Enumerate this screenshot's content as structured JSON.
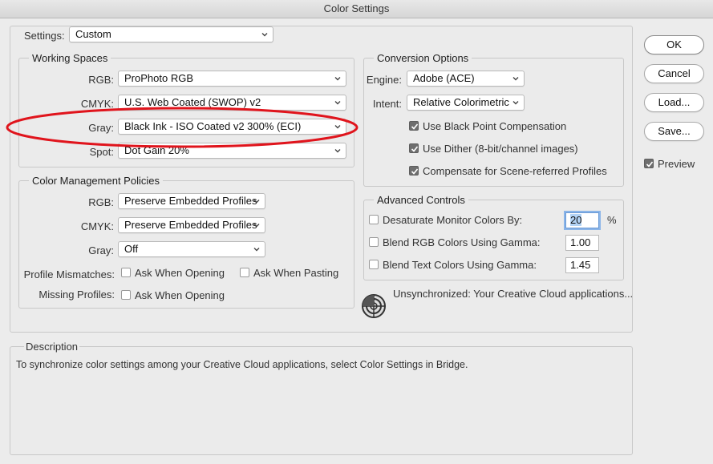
{
  "window": {
    "title": "Color Settings"
  },
  "settings": {
    "label": "Settings:",
    "value": "Custom"
  },
  "working_spaces": {
    "legend": "Working Spaces",
    "rgb": {
      "label": "RGB:",
      "value": "ProPhoto RGB"
    },
    "cmyk": {
      "label": "CMYK:",
      "value": "U.S. Web Coated (SWOP) v2"
    },
    "gray": {
      "label": "Gray:",
      "value": "Black Ink - ISO Coated v2 300% (ECI)"
    },
    "spot": {
      "label": "Spot:",
      "value": "Dot Gain 20%"
    }
  },
  "policies": {
    "legend": "Color Management Policies",
    "rgb": {
      "label": "RGB:",
      "value": "Preserve Embedded Profiles"
    },
    "cmyk": {
      "label": "CMYK:",
      "value": "Preserve Embedded Profiles"
    },
    "gray": {
      "label": "Gray:",
      "value": "Off"
    },
    "mismatches": {
      "label": "Profile Mismatches:",
      "ask_opening": "Ask When Opening",
      "ask_pasting": "Ask When Pasting"
    },
    "missing": {
      "label": "Missing Profiles:",
      "ask_opening": "Ask When Opening"
    }
  },
  "conversion": {
    "legend": "Conversion Options",
    "engine": {
      "label": "Engine:",
      "value": "Adobe (ACE)"
    },
    "intent": {
      "label": "Intent:",
      "value": "Relative Colorimetric"
    },
    "black_point": {
      "label": "Use Black Point Compensation",
      "checked": true
    },
    "dither": {
      "label": "Use Dither (8-bit/channel images)",
      "checked": true
    },
    "scene_referred": {
      "label": "Compensate for Scene-referred Profiles",
      "checked": true
    }
  },
  "advanced": {
    "legend": "Advanced Controls",
    "desaturate": {
      "label": "Desaturate Monitor Colors By:",
      "value": "20",
      "unit": "%",
      "checked": false
    },
    "blend_rgb": {
      "label": "Blend RGB Colors Using Gamma:",
      "value": "1.00",
      "checked": false
    },
    "blend_text": {
      "label": "Blend Text Colors Using Gamma:",
      "value": "1.45",
      "checked": false
    }
  },
  "sync_status": "Unsynchronized: Your Creative Cloud applications...",
  "description": {
    "legend": "Description",
    "text": "To synchronize color settings among your Creative Cloud applications, select Color Settings in Bridge."
  },
  "buttons": {
    "ok": "OK",
    "cancel": "Cancel",
    "load": "Load...",
    "save": "Save..."
  },
  "preview": {
    "label": "Preview",
    "checked": true
  },
  "colors": {
    "annotation_ellipse": "#e0141c",
    "panel_bg": "#ebebeb",
    "checkbox_on": "#6e6e6e"
  }
}
